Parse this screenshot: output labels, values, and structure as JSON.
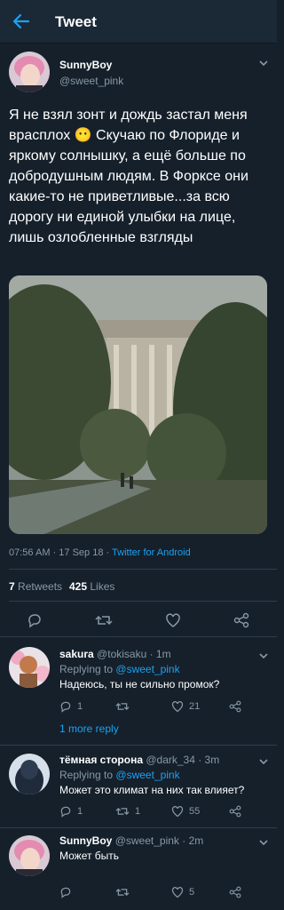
{
  "header": {
    "title": "Tweet",
    "back_icon": "back-arrow-icon"
  },
  "main_tweet": {
    "name": "SunnyBoy",
    "handle": "@sweet_pink",
    "text": "Я не взял зонт и дождь застал меня врасплох 😶 Скучаю по Флориде и яркому солнышку, а ещё больше по добродушным людям. В Форксе они какие-то не приветливые...за всю дорогу ни единой улыбки на лице, лишь озлобленные взгляды",
    "time": "07:56 AM",
    "date": "17 Sep 18",
    "dot": "·",
    "source": "Twitter for Android",
    "retweets_count": "7",
    "retweets_label": "Retweets",
    "likes_count": "425",
    "likes_label": "Likes"
  },
  "replies": [
    {
      "name": "sakura",
      "handle": "@tokisaku · 1m",
      "replying_prefix": "Replying to",
      "replying_to": "@sweet_pink",
      "text": "Надеюсь, ты не сильно промок?",
      "replies": "1",
      "retweets": "",
      "likes": "21",
      "more": "1 more reply"
    },
    {
      "name": "тёмная сторона",
      "handle": "@dark_34 · 3m",
      "replying_prefix": "Replying to",
      "replying_to": "@sweet_pink",
      "text": "Может это климат на них так влияет?",
      "replies": "1",
      "retweets": "1",
      "likes": "55"
    },
    {
      "name": "SunnyBoy",
      "handle": "@sweet_pink · 2m",
      "text": "Может быть",
      "replies": "",
      "retweets": "",
      "likes": "5"
    }
  ],
  "colors": {
    "background": "#15202b",
    "accent": "#1da1f2",
    "muted": "#8899a6"
  }
}
